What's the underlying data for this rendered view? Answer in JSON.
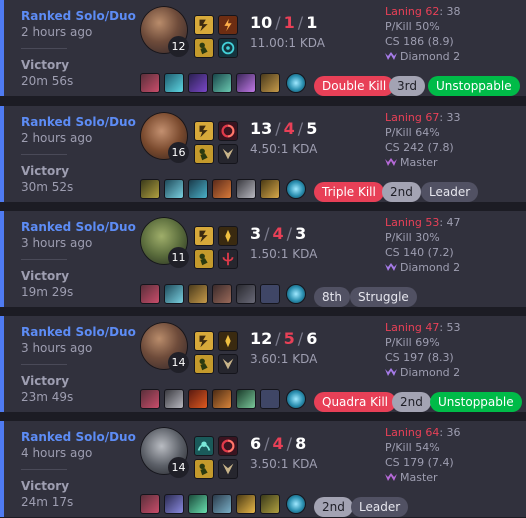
{
  "matches": [
    {
      "queue": "Ranked Solo/Duo",
      "ago": "2 hours ago",
      "result": "Victory",
      "duration": "20m 56s",
      "level": "12",
      "kills": "10",
      "deaths": "1",
      "assists": "1",
      "kda": "11.00:1 KDA",
      "laning_label": "Laning 62",
      "laning_opp": ": 38",
      "pkill": "P/Kill 50%",
      "cs": "CS 186 (8.9)",
      "tier": "Diamond 2",
      "badges": [
        "Double Kill",
        "3rd",
        "Unstoppable"
      ]
    },
    {
      "queue": "Ranked Solo/Duo",
      "ago": "2 hours ago",
      "result": "Victory",
      "duration": "30m 52s",
      "level": "16",
      "kills": "13",
      "deaths": "4",
      "assists": "5",
      "kda": "4.50:1 KDA",
      "laning_label": "Laning 67",
      "laning_opp": ": 33",
      "pkill": "P/Kill 64%",
      "cs": "CS 242 (7.8)",
      "tier": "Master",
      "badges": [
        "Triple Kill",
        "2nd",
        "Leader"
      ]
    },
    {
      "queue": "Ranked Solo/Duo",
      "ago": "3 hours ago",
      "result": "Victory",
      "duration": "19m 29s",
      "level": "11",
      "kills": "3",
      "deaths": "4",
      "assists": "3",
      "kda": "1.50:1 KDA",
      "laning_label": "Laning 53",
      "laning_opp": ": 47",
      "pkill": "P/Kill 30%",
      "cs": "CS 140 (7.2)",
      "tier": "Diamond 2",
      "badges": [
        "8th",
        "Struggle"
      ]
    },
    {
      "queue": "Ranked Solo/Duo",
      "ago": "3 hours ago",
      "result": "Victory",
      "duration": "23m 49s",
      "level": "14",
      "kills": "12",
      "deaths": "5",
      "assists": "6",
      "kda": "3.60:1 KDA",
      "laning_label": "Laning 47",
      "laning_opp": ": 53",
      "pkill": "P/Kill 69%",
      "cs": "CS 197 (8.3)",
      "tier": "Diamond 2",
      "badges": [
        "Quadra Kill",
        "2nd",
        "Unstoppable"
      ]
    },
    {
      "queue": "Ranked Solo/Duo",
      "ago": "4 hours ago",
      "result": "Victory",
      "duration": "24m 17s",
      "level": "14",
      "kills": "6",
      "deaths": "4",
      "assists": "8",
      "kda": "3.50:1 KDA",
      "laning_label": "Laning 64",
      "laning_opp": ": 36",
      "pkill": "P/Kill 54%",
      "cs": "CS 179 (7.4)",
      "tier": "Master",
      "badges": [
        "2nd",
        "Leader"
      ]
    }
  ],
  "colors": {
    "accent": "#5d8cf5",
    "death": "#e84057",
    "badge_red": "#e84057",
    "badge_green": "#00bb48",
    "badge_grey": "#a3a3b3",
    "badge_dark": "#515163"
  }
}
